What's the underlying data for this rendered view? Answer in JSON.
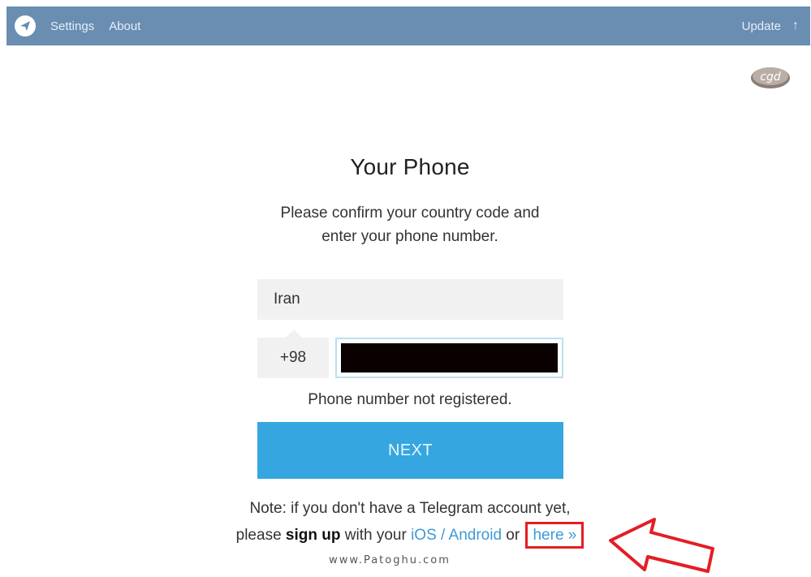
{
  "topbar": {
    "settings": "Settings",
    "about": "About",
    "update": "Update",
    "update_arrow": "🠕"
  },
  "login": {
    "title": "Your Phone",
    "subtitle_line1": "Please confirm your country code and",
    "subtitle_line2": "enter your phone number.",
    "country": "Iran",
    "country_code": "+98",
    "error": "Phone number not registered.",
    "next_label": "NEXT"
  },
  "note": {
    "line1": "Note: if you don't have a Telegram account yet,",
    "please": "please ",
    "sign_up": "sign up",
    "with_your": " with your ",
    "ios_android": "iOS / Android",
    "or": " or ",
    "here": "here »"
  },
  "watermark": "www.Patoghu.com",
  "brand_badge_text": "cgd",
  "colors": {
    "topbar": "#6a8db2",
    "next_button": "#35a6e0",
    "link": "#3d9bd6",
    "annotation_red": "#e31e24"
  },
  "icons": {
    "app_logo": "telegram-plane-icon",
    "update": "arrow-up-icon",
    "annotation": "red-pointer-arrow-icon"
  }
}
